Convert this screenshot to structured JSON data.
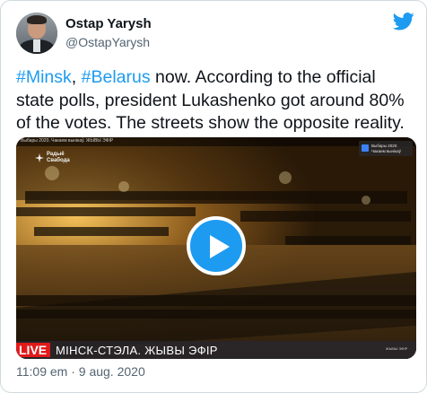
{
  "author": {
    "name": "Ostap Yarysh",
    "handle": "@OstapYarysh"
  },
  "tweet": {
    "hashtag_1": "#Minsk",
    "separator": ", ",
    "hashtag_2": "#Belarus",
    "body": " now. According to the official state polls, president Lukashenko got around 80% of the votes. The streets show the opposite reality."
  },
  "video": {
    "top_caption": "Выбары 2020. Чакаем вынікаў. ЖЫВЫ ЭФІР",
    "channel_logo": "Радыё Свабода",
    "badge_text": "Выбары 2020. Чакаем вынікаў",
    "live_label": "LIVE",
    "lower_third": "МІНСК-СТЭЛА. ЖЫВЫ ЭФІР",
    "corner_tag": "ЖЫВЫ ЭФІР"
  },
  "meta": {
    "timestamp": "11:09 em · 9 aug. 2020"
  },
  "colors": {
    "accent": "#1d9bf0",
    "text": "#0f1419",
    "muted": "#536471",
    "live_red": "#e11a1a"
  },
  "icons": {
    "brand": "twitter-bird-icon",
    "play": "play-icon"
  }
}
